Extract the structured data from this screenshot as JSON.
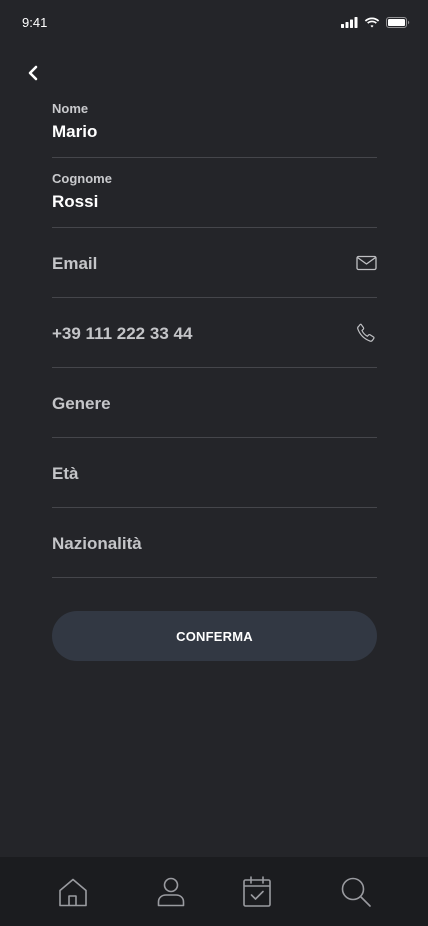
{
  "status_bar": {
    "time": "9:41"
  },
  "form": {
    "nome": {
      "label": "Nome",
      "value": "Mario"
    },
    "cognome": {
      "label": "Cognome",
      "value": "Rossi"
    },
    "email": {
      "placeholder": "Email",
      "icon": "mail-icon"
    },
    "phone": {
      "value": "+39 111 222 33 44",
      "icon": "phone-icon"
    },
    "genere": {
      "placeholder": "Genere"
    },
    "eta": {
      "placeholder": "Età"
    },
    "nazionalita": {
      "placeholder": "Nazionalità"
    }
  },
  "confirm_label": "CONFERMA",
  "bottom_nav": {
    "items": [
      "home-icon",
      "profile-icon",
      "calendar-check-icon",
      "search-icon"
    ]
  },
  "colors": {
    "background": "#242529",
    "nav_background": "#1b1c1f",
    "button": "#323843",
    "divider": "#45464b"
  }
}
